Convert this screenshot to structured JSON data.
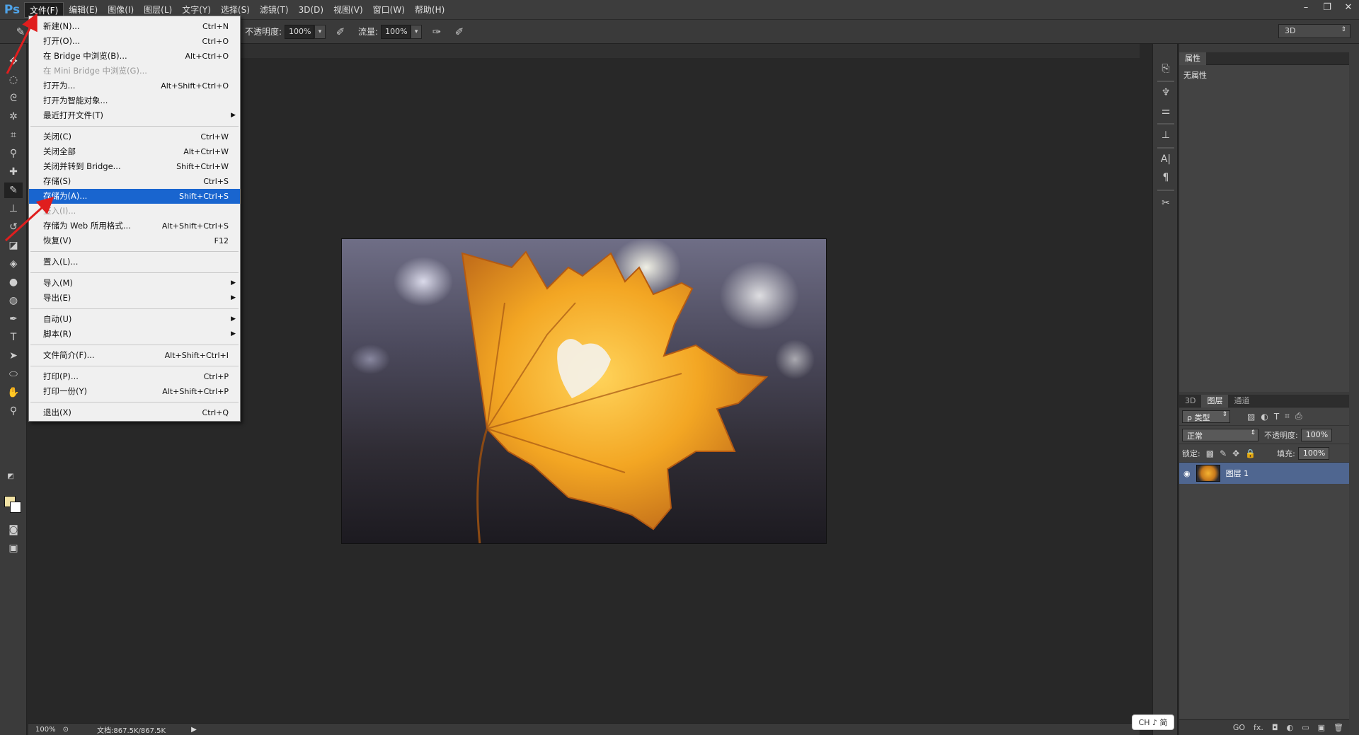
{
  "app": {
    "logo": "Ps"
  },
  "menubar": {
    "items": [
      "文件(F)",
      "编辑(E)",
      "图像(I)",
      "图层(L)",
      "文字(Y)",
      "选择(S)",
      "滤镜(T)",
      "3D(D)",
      "视图(V)",
      "窗口(W)",
      "帮助(H)"
    ],
    "active_index": 0
  },
  "window_controls": {
    "minimize": "–",
    "restore": "❐",
    "close": "✕"
  },
  "options_bar": {
    "opacity_label": "不透明度:",
    "opacity_value": "100%",
    "flow_label": "流量:",
    "flow_value": "100%",
    "workspace": "3D"
  },
  "file_menu": {
    "groups": [
      [
        {
          "label": "新建(N)...",
          "shortcut": "Ctrl+N"
        },
        {
          "label": "打开(O)...",
          "shortcut": "Ctrl+O"
        },
        {
          "label": "在 Bridge 中浏览(B)...",
          "shortcut": "Alt+Ctrl+O"
        },
        {
          "label": "在 Mini Bridge 中浏览(G)...",
          "shortcut": "",
          "disabled": true
        },
        {
          "label": "打开为...",
          "shortcut": "Alt+Shift+Ctrl+O"
        },
        {
          "label": "打开为智能对象...",
          "shortcut": ""
        },
        {
          "label": "最近打开文件(T)",
          "shortcut": "",
          "submenu": true
        }
      ],
      [
        {
          "label": "关闭(C)",
          "shortcut": "Ctrl+W"
        },
        {
          "label": "关闭全部",
          "shortcut": "Alt+Ctrl+W"
        },
        {
          "label": "关闭并转到 Bridge...",
          "shortcut": "Shift+Ctrl+W"
        },
        {
          "label": "存储(S)",
          "shortcut": "Ctrl+S"
        },
        {
          "label": "存储为(A)...",
          "shortcut": "Shift+Ctrl+S",
          "highlighted": true
        },
        {
          "label": "签入(I)...",
          "shortcut": "",
          "disabled": true
        },
        {
          "label": "存储为 Web 所用格式...",
          "shortcut": "Alt+Shift+Ctrl+S"
        },
        {
          "label": "恢复(V)",
          "shortcut": "F12"
        }
      ],
      [
        {
          "label": "置入(L)...",
          "shortcut": ""
        }
      ],
      [
        {
          "label": "导入(M)",
          "shortcut": "",
          "submenu": true
        },
        {
          "label": "导出(E)",
          "shortcut": "",
          "submenu": true
        }
      ],
      [
        {
          "label": "自动(U)",
          "shortcut": "",
          "submenu": true
        },
        {
          "label": "脚本(R)",
          "shortcut": "",
          "submenu": true
        }
      ],
      [
        {
          "label": "文件简介(F)...",
          "shortcut": "Alt+Shift+Ctrl+I"
        }
      ],
      [
        {
          "label": "打印(P)...",
          "shortcut": "Ctrl+P"
        },
        {
          "label": "打印一份(Y)",
          "shortcut": "Alt+Shift+Ctrl+P"
        }
      ],
      [
        {
          "label": "退出(X)",
          "shortcut": "Ctrl+Q"
        }
      ]
    ]
  },
  "properties_panel": {
    "tab": "属性",
    "empty_text": "无属性"
  },
  "layers_panel": {
    "tabs": [
      "3D",
      "图层",
      "通道"
    ],
    "active_tab": 1,
    "filter_label": "ρ 类型",
    "blend_mode": "正常",
    "opacity_label": "不透明度:",
    "opacity_value": "100%",
    "lock_label": "锁定:",
    "fill_label": "填充:",
    "fill_value": "100%",
    "layer_name": "图层 1",
    "footer_icons": [
      "GO",
      "fx.",
      "◘",
      "◐",
      "▭",
      "▣",
      "🗑"
    ]
  },
  "status_bar": {
    "zoom": "100%",
    "doc_info": "文档:867.5K/867.5K"
  },
  "ime": {
    "text": "CH ♪ 简"
  },
  "colors": {
    "highlight": "#1965cf",
    "annotation_arrow": "#e01e1e",
    "layer_selected": "#4f6690"
  }
}
